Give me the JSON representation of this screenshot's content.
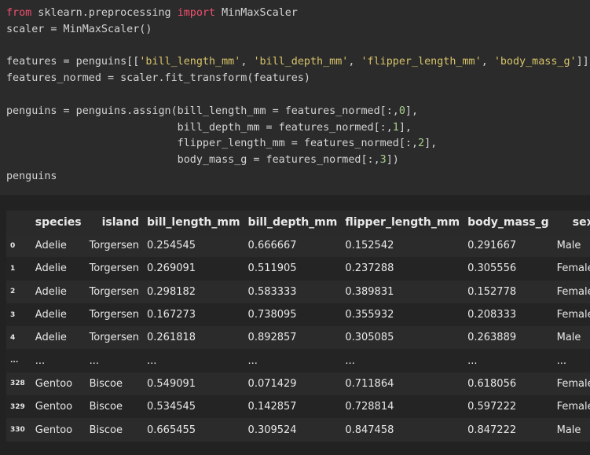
{
  "code": {
    "l1_kw1": "from",
    "l1_mod": " sklearn.preprocessing ",
    "l1_kw2": "import",
    "l1_name": " MinMaxScaler",
    "l2": "scaler = MinMaxScaler()",
    "l4_a": "features = penguins[[",
    "l4_s1": "'bill_length_mm'",
    "l4_sep1": ", ",
    "l4_s2": "'bill_depth_mm'",
    "l4_sep2": ", ",
    "l4_s3": "'flipper_length_mm'",
    "l4_sep3": ", ",
    "l4_s4": "'body_mass_g'",
    "l4_end": "]]",
    "l5": "features_normed = scaler.fit_transform(features)",
    "l7_a": "penguins = penguins.assign(bill_length_mm = features_normed[:,",
    "l7_n": "0",
    "l7_end": "],",
    "l8_a": "                           bill_depth_mm = features_normed[:,",
    "l8_n": "1",
    "l8_end": "],",
    "l9_a": "                           flipper_length_mm = features_normed[:,",
    "l9_n": "2",
    "l9_end": "],",
    "l10_a": "                           body_mass_g = features_normed[:,",
    "l10_n": "3",
    "l10_end": "])",
    "l11": "penguins"
  },
  "table": {
    "headers": [
      "species",
      "island",
      "bill_length_mm",
      "bill_depth_mm",
      "flipper_length_mm",
      "body_mass_g",
      "sex"
    ],
    "rows": [
      {
        "idx": "0",
        "cells": [
          "Adelie",
          "Torgersen",
          "0.254545",
          "0.666667",
          "0.152542",
          "0.291667",
          "Male"
        ]
      },
      {
        "idx": "1",
        "cells": [
          "Adelie",
          "Torgersen",
          "0.269091",
          "0.511905",
          "0.237288",
          "0.305556",
          "Female"
        ]
      },
      {
        "idx": "2",
        "cells": [
          "Adelie",
          "Torgersen",
          "0.298182",
          "0.583333",
          "0.389831",
          "0.152778",
          "Female"
        ]
      },
      {
        "idx": "3",
        "cells": [
          "Adelie",
          "Torgersen",
          "0.167273",
          "0.738095",
          "0.355932",
          "0.208333",
          "Female"
        ]
      },
      {
        "idx": "4",
        "cells": [
          "Adelie",
          "Torgersen",
          "0.261818",
          "0.892857",
          "0.305085",
          "0.263889",
          "Male"
        ]
      },
      {
        "idx": "...",
        "cells": [
          "...",
          "...",
          "...",
          "...",
          "...",
          "...",
          "..."
        ]
      },
      {
        "idx": "328",
        "cells": [
          "Gentoo",
          "Biscoe",
          "0.549091",
          "0.071429",
          "0.711864",
          "0.618056",
          "Female"
        ]
      },
      {
        "idx": "329",
        "cells": [
          "Gentoo",
          "Biscoe",
          "0.534545",
          "0.142857",
          "0.728814",
          "0.597222",
          "Female"
        ]
      },
      {
        "idx": "330",
        "cells": [
          "Gentoo",
          "Biscoe",
          "0.665455",
          "0.309524",
          "0.847458",
          "0.847222",
          "Male"
        ]
      }
    ]
  }
}
